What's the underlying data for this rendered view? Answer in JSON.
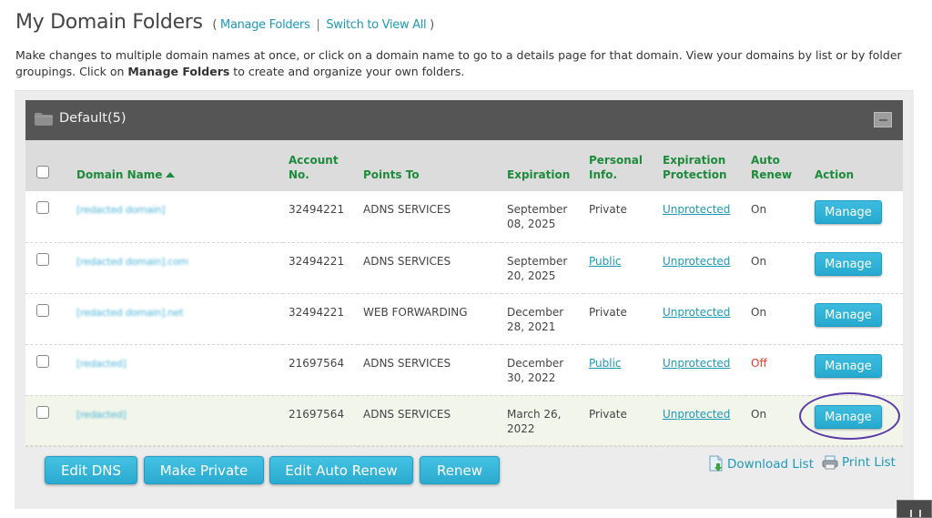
{
  "header": {
    "title": "My Domain Folders",
    "open_paren": "( ",
    "manage_folders_link": "Manage Folders",
    "separator": "|",
    "switch_view_link": "Switch to View All",
    "close_paren": " )"
  },
  "intro": {
    "text_before": "Make changes to multiple domain names at once, or click on a domain name to go to a details page for that domain. View your domains by list or by folder groupings. Click on ",
    "bold": "Manage Folders",
    "text_after": " to create and organize your own folders."
  },
  "folder": {
    "icon": "folder-icon",
    "label": "Default(5)",
    "collapse_icon": "minus-icon"
  },
  "table": {
    "columns": {
      "domain_name": "Domain Name",
      "account_no": "Account No.",
      "points_to": "Points To",
      "expiration": "Expiration",
      "personal_info": "Personal Info.",
      "expiration_protection": "Expiration Protection",
      "auto_renew": "Auto Renew",
      "action": "Action"
    },
    "sort": {
      "column": "Domain Name",
      "direction": "ascending"
    },
    "rows": [
      {
        "domain": "[redacted domain]",
        "account": "32494221",
        "points_to": "ADNS SERVICES",
        "expiration": "September 08, 2025",
        "personal_info": "Private",
        "personal_info_is_link": false,
        "protection": "Unprotected",
        "auto_renew": "On",
        "action": "Manage"
      },
      {
        "domain": "[redacted domain].com",
        "account": "32494221",
        "points_to": "ADNS SERVICES",
        "expiration": "September 20, 2025",
        "personal_info": "Public",
        "personal_info_is_link": true,
        "protection": "Unprotected",
        "auto_renew": "On",
        "action": "Manage"
      },
      {
        "domain": "[redacted domain].net",
        "account": "32494221",
        "points_to": "WEB FORWARDING",
        "expiration": "December 28, 2021",
        "personal_info": "Private",
        "personal_info_is_link": false,
        "protection": "Unprotected",
        "auto_renew": "On",
        "action": "Manage"
      },
      {
        "domain": "[redacted]",
        "account": "21697564",
        "points_to": "ADNS SERVICES",
        "expiration": "December 30, 2022",
        "personal_info": "Public",
        "personal_info_is_link": true,
        "protection": "Unprotected",
        "auto_renew": "Off",
        "action": "Manage"
      },
      {
        "domain": "[redacted]",
        "account": "21697564",
        "points_to": "ADNS SERVICES",
        "expiration": "March 26, 2022",
        "personal_info": "Private",
        "personal_info_is_link": false,
        "protection": "Unprotected",
        "auto_renew": "On",
        "action": "Manage",
        "highlighted": true
      }
    ]
  },
  "bulk_actions": {
    "edit_dns": "Edit DNS",
    "make_private": "Make Private",
    "edit_auto_renew": "Edit Auto Renew",
    "renew": "Renew"
  },
  "list_links": {
    "download": "Download List",
    "download_icon": "download-file-icon",
    "print": "Print List",
    "print_icon": "printer-icon"
  },
  "colors": {
    "accent": "#2aaad0",
    "header_green": "#1e8a3c",
    "folder_bar": "#555555",
    "off_red": "#e53a2a",
    "highlight_ring": "#5c3aa8"
  }
}
